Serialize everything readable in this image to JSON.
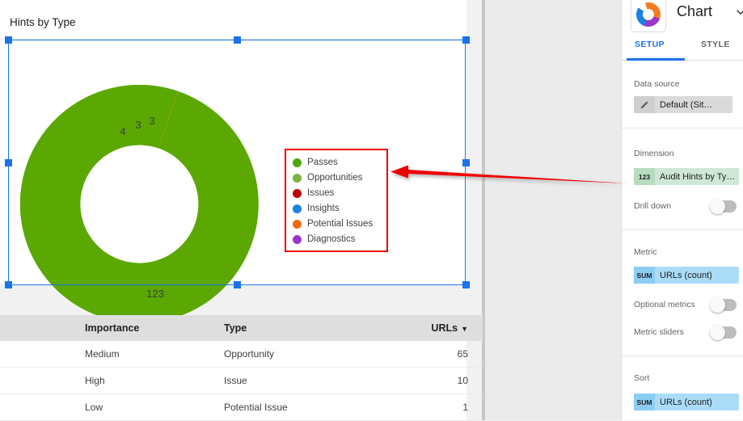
{
  "report": {
    "chart_title": "Hints by Type"
  },
  "chart_data": {
    "type": "pie",
    "title": "Hints by Type",
    "categories": [
      "Passes",
      "Opportunities",
      "Issues",
      "Insights",
      "Potential Issues",
      "Diagnostics"
    ],
    "values": [
      123,
      4,
      3,
      3,
      1,
      0
    ],
    "labels_shown": [
      "123",
      "4",
      "3",
      "3",
      "",
      ""
    ],
    "colors": [
      "#5BA803",
      "#7CB342",
      "#C90000",
      "#1A82E2",
      "#F26B0F",
      "#9C36C9"
    ],
    "legend_position": "inside-right",
    "donut_hole_ratio": 0.5,
    "xlabel": "",
    "ylabel": ""
  },
  "legend": {
    "items": [
      {
        "label": "Passes",
        "color": "#4CA80B"
      },
      {
        "label": "Opportunities",
        "color": "#7CB342"
      },
      {
        "label": "Issues",
        "color": "#C00000"
      },
      {
        "label": "Insights",
        "color": "#1A82E2"
      },
      {
        "label": "Potential Issues",
        "color": "#F26B0F"
      },
      {
        "label": "Diagnostics",
        "color": "#9C36C9"
      }
    ]
  },
  "table": {
    "columns": [
      "Importance",
      "Type",
      "URLs"
    ],
    "sort_indicator": "▼",
    "rows": [
      {
        "importance": "Medium",
        "type": "Opportunity",
        "urls": "65"
      },
      {
        "importance": "High",
        "type": "Issue",
        "urls": "10"
      },
      {
        "importance": "Low",
        "type": "Potential Issue",
        "urls": "1"
      }
    ]
  },
  "panel": {
    "title": "Chart",
    "icon": "donut-chart-icon",
    "chevron": "chevron-down-icon",
    "tabs": [
      {
        "label": "SETUP",
        "active": true
      },
      {
        "label": "STYLE",
        "active": false
      }
    ],
    "data_source": {
      "label": "Data source",
      "icon": "pencil-icon",
      "value": "Default (Sit…"
    },
    "dimension": {
      "label": "Dimension",
      "badge": "123",
      "value": "Audit Hints by Ty…"
    },
    "drill_down": {
      "label": "Drill down",
      "enabled": false
    },
    "metric": {
      "label": "Metric",
      "badge": "SUM",
      "value": "URLs (count)"
    },
    "optional_metrics": {
      "label": "Optional metrics",
      "enabled": false
    },
    "metric_sliders": {
      "label": "Metric sliders",
      "enabled": false
    },
    "sort": {
      "label": "Sort",
      "badge": "SUM",
      "value": "URLs (count)"
    }
  },
  "annotation": {
    "arrow_color": "#EE0000",
    "highlight_color": "#EE0000"
  }
}
